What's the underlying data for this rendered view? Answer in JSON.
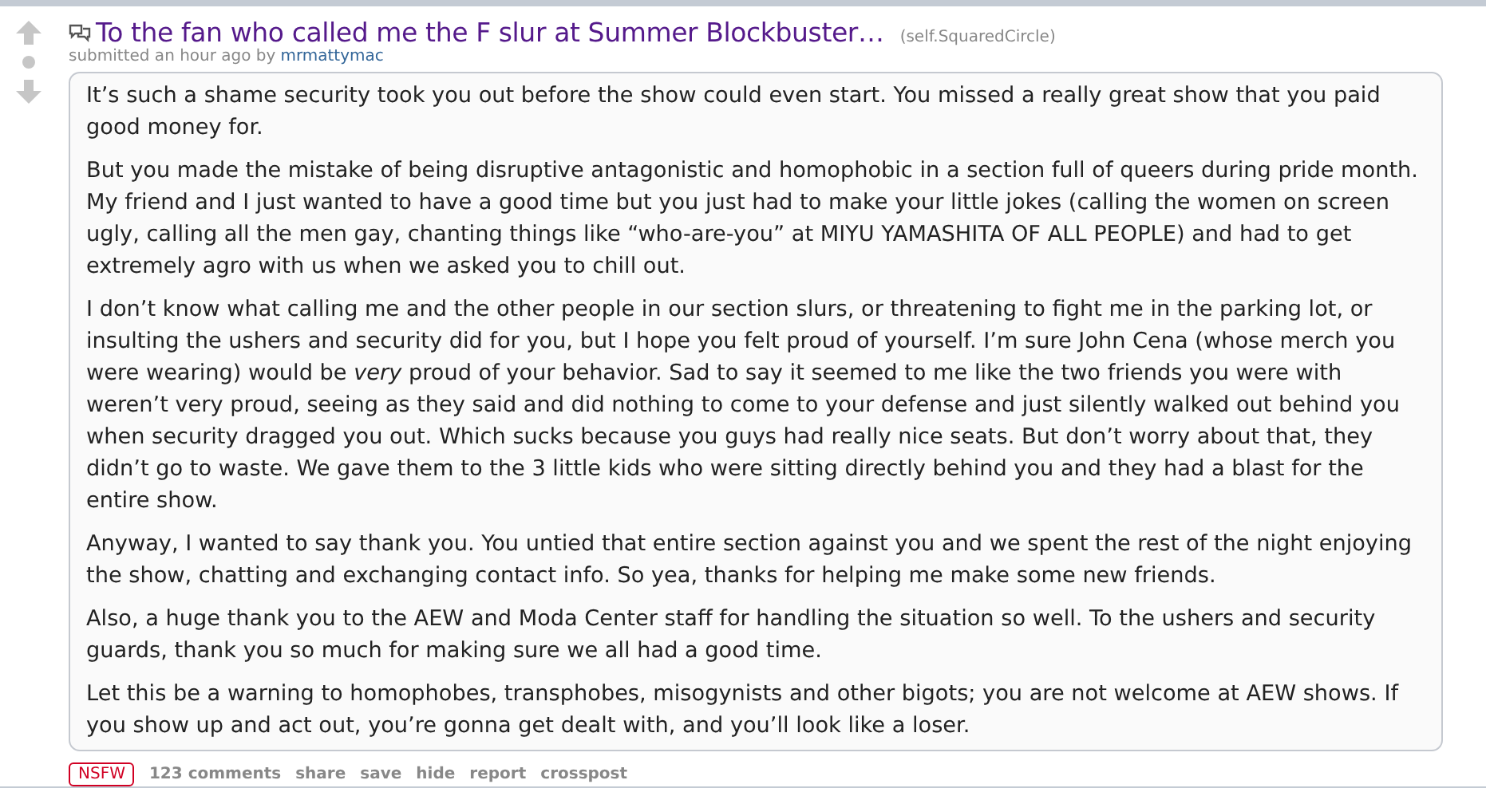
{
  "post": {
    "title": "To the fan who called me the F slur at Summer Blockbuster…",
    "domain": "(self.SquaredCircle)",
    "tagline": "submitted an hour ago by",
    "author": "mrmattymac",
    "paragraphs": [
      "It’s such a shame security took you out before the show could even start. You missed a really great show that you paid good money for.",
      "But you made the mistake of being disruptive antagonistic and homophobic in a section full of queers during pride month. My friend and I just wanted to have a good time but you just had to make your little jokes (calling the women on screen ugly, calling all the men gay, chanting things like “who-are-you” at MIYU YAMASHITA OF ALL PEOPLE) and had to get extremely agro with us when we asked you to chill out.",
      "I don’t know what calling me and the other people in our section slurs, or threatening to fight me in the parking lot, or insulting the ushers and security did for you, but I hope you felt proud of yourself. I’m sure John Cena (whose merch you were wearing) would be *very* proud of your behavior. Sad to say it seemed to me like the two friends you were with weren’t very proud, seeing as they said and did nothing to come to your defense and just silently walked out behind you when security dragged you out. Which sucks because you guys had really nice seats. But don’t worry about that, they didn’t go to waste. We gave them to the 3 little kids who were sitting directly behind you and they had a blast for the entire show.",
      "Anyway, I wanted to say thank you. You untied that entire section against you and we spent the rest of the night enjoying the show, chatting and exchanging contact info. So yea, thanks for helping me make some new friends.",
      "Also, a huge thank you to the AEW and Moda Center staff for handling the situation so well. To the ushers and security guards, thank you so much for making sure we all had a good time.",
      "Let this be a warning to homophobes, transphobes, misogynists and other bigots; you are not welcome at AEW shows. If you show up and act out, you’re gonna get dealt with, and you’ll look like a loser."
    ],
    "nsfw": "NSFW",
    "actions": [
      "123 comments",
      "share",
      "save",
      "hide",
      "report",
      "crosspost"
    ]
  }
}
